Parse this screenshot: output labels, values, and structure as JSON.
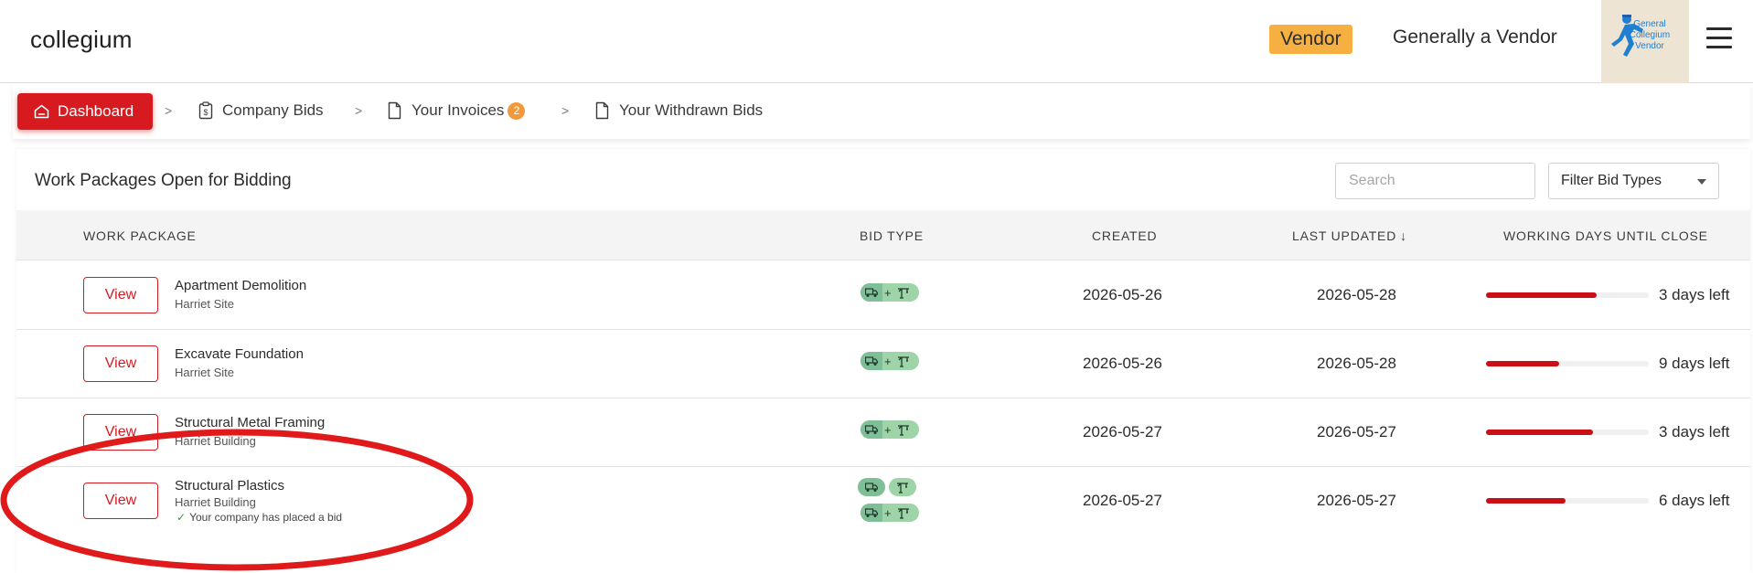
{
  "header": {
    "brand": "collegium",
    "role_badge": "Vendor",
    "user_name": "Generally a Vendor",
    "logo_text": [
      "General",
      "Collegium",
      "Vendor"
    ],
    "menu_icon": "hamburger-menu-icon"
  },
  "breadcrumbs": {
    "dashboard": "Dashboard",
    "separator": ">",
    "company_bids": "Company Bids",
    "your_invoices": "Your Invoices",
    "invoices_count": "2",
    "withdrawn_bids": "Your Withdrawn Bids"
  },
  "panel": {
    "title": "Work Packages Open for Bidding",
    "search_placeholder": "Search",
    "filter_label": "Filter Bid Types"
  },
  "table": {
    "columns": {
      "work_package": "WORK PACKAGE",
      "bid_type": "BID TYPE",
      "created": "CREATED",
      "last_updated": "LAST UPDATED",
      "last_updated_sort": "↓",
      "working_days": "WORKING DAYS UNTIL CLOSE"
    },
    "view_label": "View",
    "rows": [
      {
        "name": "Apartment Demolition",
        "site": "Harriet Site",
        "created": "2026-05-26",
        "updated": "2026-05-28",
        "days_left": "3 days left",
        "progress": 0.68,
        "bid_types": [
          "truck+crane"
        ],
        "note": ""
      },
      {
        "name": "Excavate Foundation",
        "site": "Harriet Site",
        "created": "2026-05-26",
        "updated": "2026-05-28",
        "days_left": "9 days left",
        "progress": 0.45,
        "bid_types": [
          "truck+crane"
        ],
        "note": ""
      },
      {
        "name": "Structural Metal Framing",
        "site": "Harriet Building",
        "created": "2026-05-27",
        "updated": "2026-05-27",
        "days_left": "3 days left",
        "progress": 0.66,
        "bid_types": [
          "truck+crane"
        ],
        "note": ""
      },
      {
        "name": "Structural Plastics",
        "site": "Harriet Building",
        "created": "2026-05-27",
        "updated": "2026-05-27",
        "days_left": "6 days left",
        "progress": 0.49,
        "bid_types": [
          "truck",
          "crane",
          "truck+crane"
        ],
        "note": "Your company has placed a bid"
      }
    ]
  },
  "colors": {
    "primary_red": "#d71920",
    "badge_orange": "#f6b042",
    "progress_red": "#cc0f16",
    "pill_green": "#9fd3a8"
  }
}
